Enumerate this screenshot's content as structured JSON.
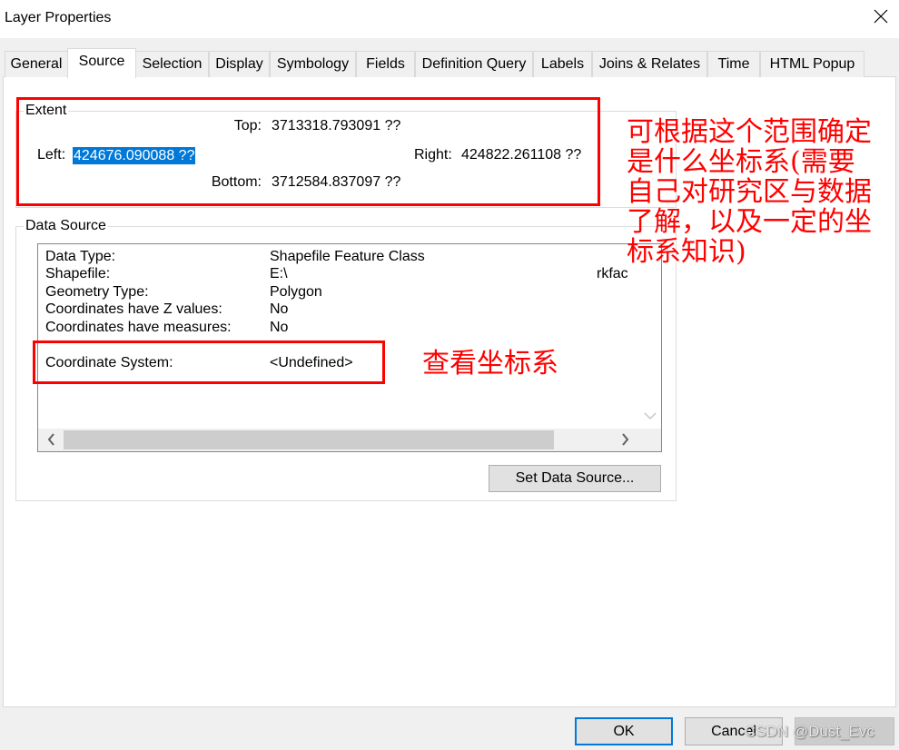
{
  "window": {
    "title": "Layer Properties"
  },
  "tabs": [
    {
      "label": "General",
      "selected": false
    },
    {
      "label": "Source",
      "selected": true
    },
    {
      "label": "Selection",
      "selected": false
    },
    {
      "label": "Display",
      "selected": false
    },
    {
      "label": "Symbology",
      "selected": false
    },
    {
      "label": "Fields",
      "selected": false
    },
    {
      "label": "Definition Query",
      "selected": false
    },
    {
      "label": "Labels",
      "selected": false
    },
    {
      "label": "Joins & Relates",
      "selected": false
    },
    {
      "label": "Time",
      "selected": false
    },
    {
      "label": "HTML Popup",
      "selected": false
    }
  ],
  "extent": {
    "group_label": "Extent",
    "top": {
      "label": "Top:",
      "value": "3713318.793091 ??"
    },
    "left": {
      "label": "Left:",
      "value": "424676.090088 ??",
      "value_selected": true
    },
    "right": {
      "label": "Right:",
      "value": "424822.261108 ??"
    },
    "bottom": {
      "label": "Bottom:",
      "value": "3712584.837097 ??"
    }
  },
  "data_source": {
    "group_label": "Data Source",
    "rows": [
      {
        "key": "Data Type:",
        "value": "Shapefile Feature Class"
      },
      {
        "key": "Shapefile:",
        "value": "E:\\",
        "value_tail": "rkfac"
      },
      {
        "key": "Geometry Type:",
        "value": "Polygon"
      },
      {
        "key": "Coordinates have Z values:",
        "value": "No"
      },
      {
        "key": "Coordinates have measures:",
        "value": "No"
      },
      {
        "key": "Coordinate System:",
        "value": "<Undefined>"
      }
    ],
    "set_data_source_button": "Set Data Source..."
  },
  "annotations": {
    "extent_note_lines": [
      "可根据这个范围确定",
      "是什么坐标系(需要",
      "自己对研究区与数据",
      "了解，以及一定的坐",
      "标系知识)"
    ],
    "coordinate_system_note": "查看坐标系"
  },
  "footer": {
    "ok_label": "OK",
    "cancel_label": "Cancel"
  },
  "watermark": "CSDN @Dust_Evc",
  "colors": {
    "selection_highlight": "#0078d7",
    "annotation_red": "#ff0000",
    "default_button_border": "#0078d7"
  },
  "icons": {
    "close": "close-icon",
    "scroll_down": "chevron-down-icon",
    "scroll_left": "chevron-left-icon",
    "scroll_right": "chevron-right-icon"
  }
}
